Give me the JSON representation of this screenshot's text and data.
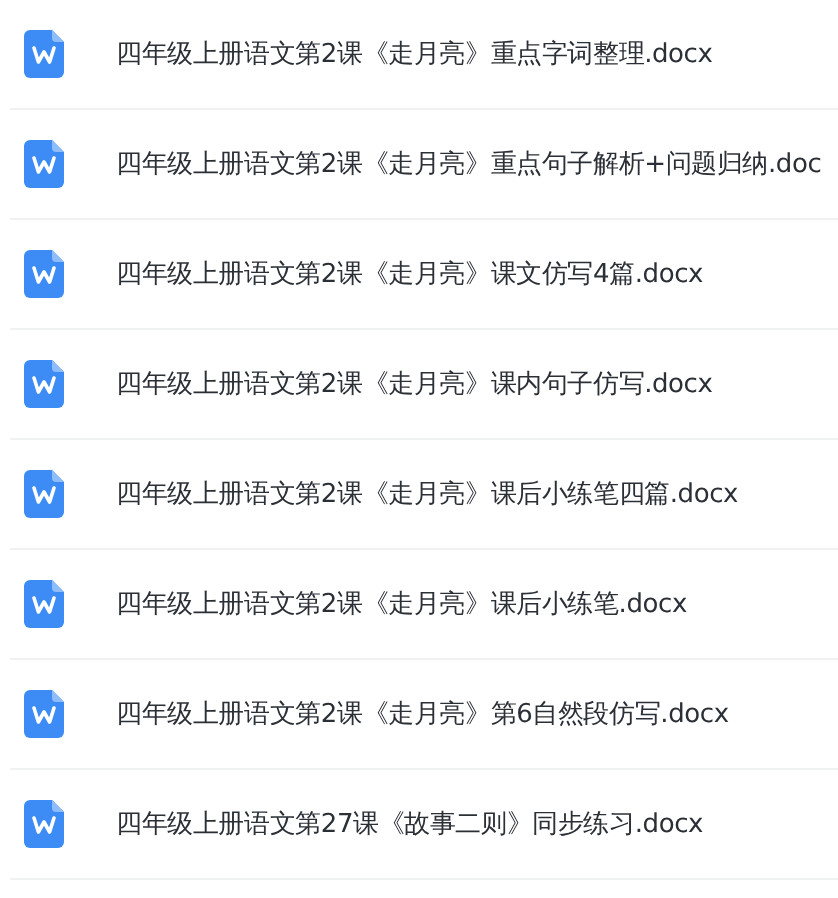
{
  "files": [
    {
      "name": "四年级上册语文第2课《走月亮》重点字词整理.docx",
      "kind": "word"
    },
    {
      "name": "四年级上册语文第2课《走月亮》重点句子解析+问题归纳.doc",
      "kind": "word"
    },
    {
      "name": "四年级上册语文第2课《走月亮》课文仿写4篇.docx",
      "kind": "word"
    },
    {
      "name": "四年级上册语文第2课《走月亮》课内句子仿写.docx",
      "kind": "word"
    },
    {
      "name": "四年级上册语文第2课《走月亮》课后小练笔四篇.docx",
      "kind": "word"
    },
    {
      "name": "四年级上册语文第2课《走月亮》课后小练笔.docx",
      "kind": "word"
    },
    {
      "name": "四年级上册语文第2课《走月亮》第6自然段仿写.docx",
      "kind": "word"
    },
    {
      "name": "四年级上册语文第27课《故事二则》同步练习.docx",
      "kind": "word"
    }
  ]
}
